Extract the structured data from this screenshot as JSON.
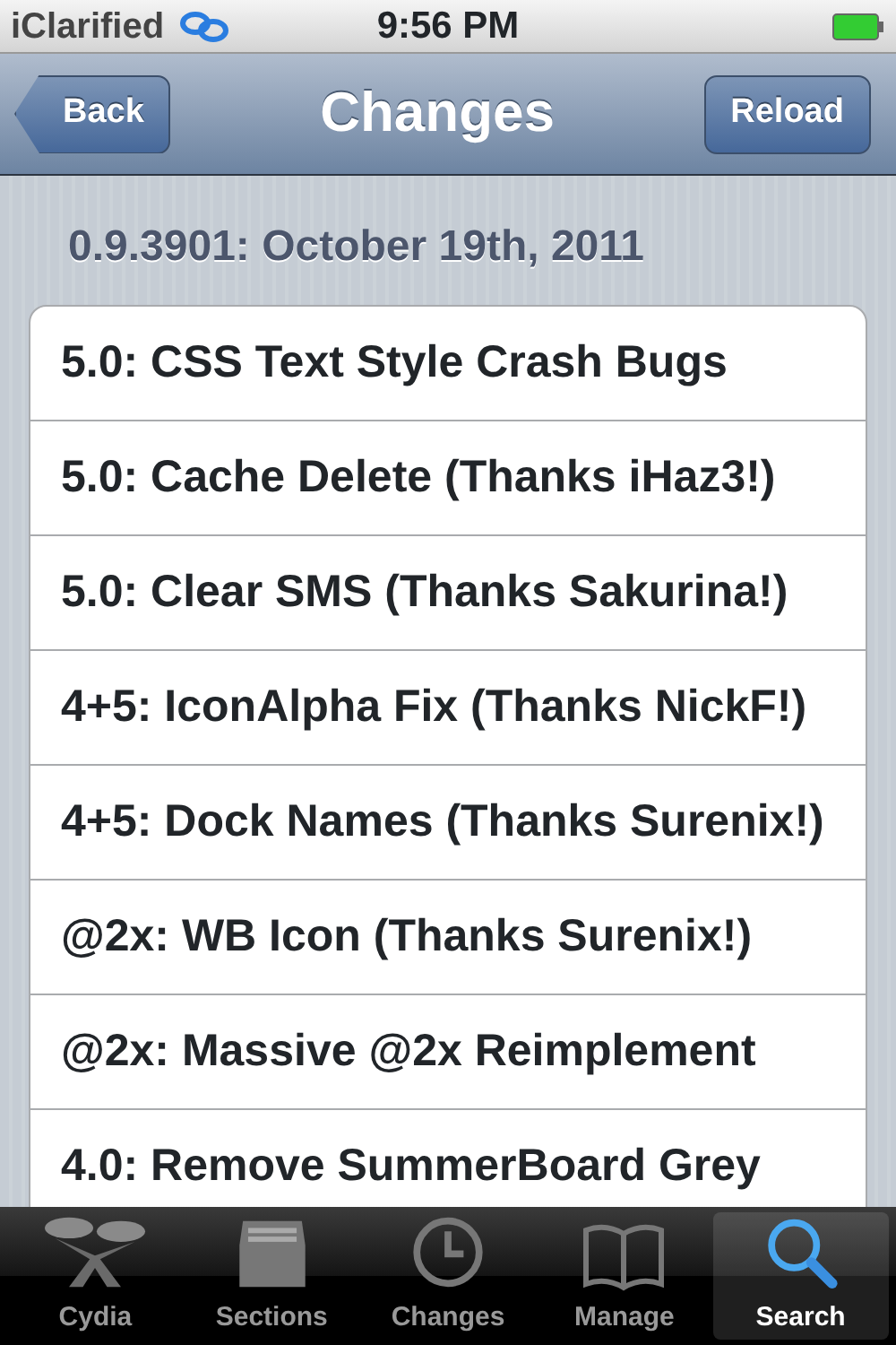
{
  "status_bar": {
    "carrier": "iClarified",
    "time": "9:56 PM"
  },
  "nav_bar": {
    "back": "Back",
    "title": "Changes",
    "action": "Reload"
  },
  "section": {
    "header": "0.9.3901: October 19th, 2011",
    "items": [
      {
        "text": "5.0: CSS Text Style Crash Bugs"
      },
      {
        "text": "5.0: Cache Delete (Thanks iHaz3!)"
      },
      {
        "text": "5.0: Clear SMS (Thanks Sakurina!)"
      },
      {
        "text": "4+5: IconAlpha Fix (Thanks NickF!)"
      },
      {
        "text": "4+5: Dock Names (Thanks Surenix!)"
      },
      {
        "text": "@2x: WB Icon (Thanks Surenix!)"
      },
      {
        "text": "@2x: Massive @2x Reimplement"
      },
      {
        "text": "4.0: Remove SummerBoard Grey"
      }
    ]
  },
  "tab_bar": [
    {
      "kind": "cydia",
      "label": "Cydia",
      "selected": false
    },
    {
      "kind": "sections",
      "label": "Sections",
      "selected": false
    },
    {
      "kind": "changes",
      "label": "Changes",
      "selected": false
    },
    {
      "kind": "manage",
      "label": "Manage",
      "selected": false
    },
    {
      "kind": "search",
      "label": "Search",
      "selected": true
    }
  ]
}
